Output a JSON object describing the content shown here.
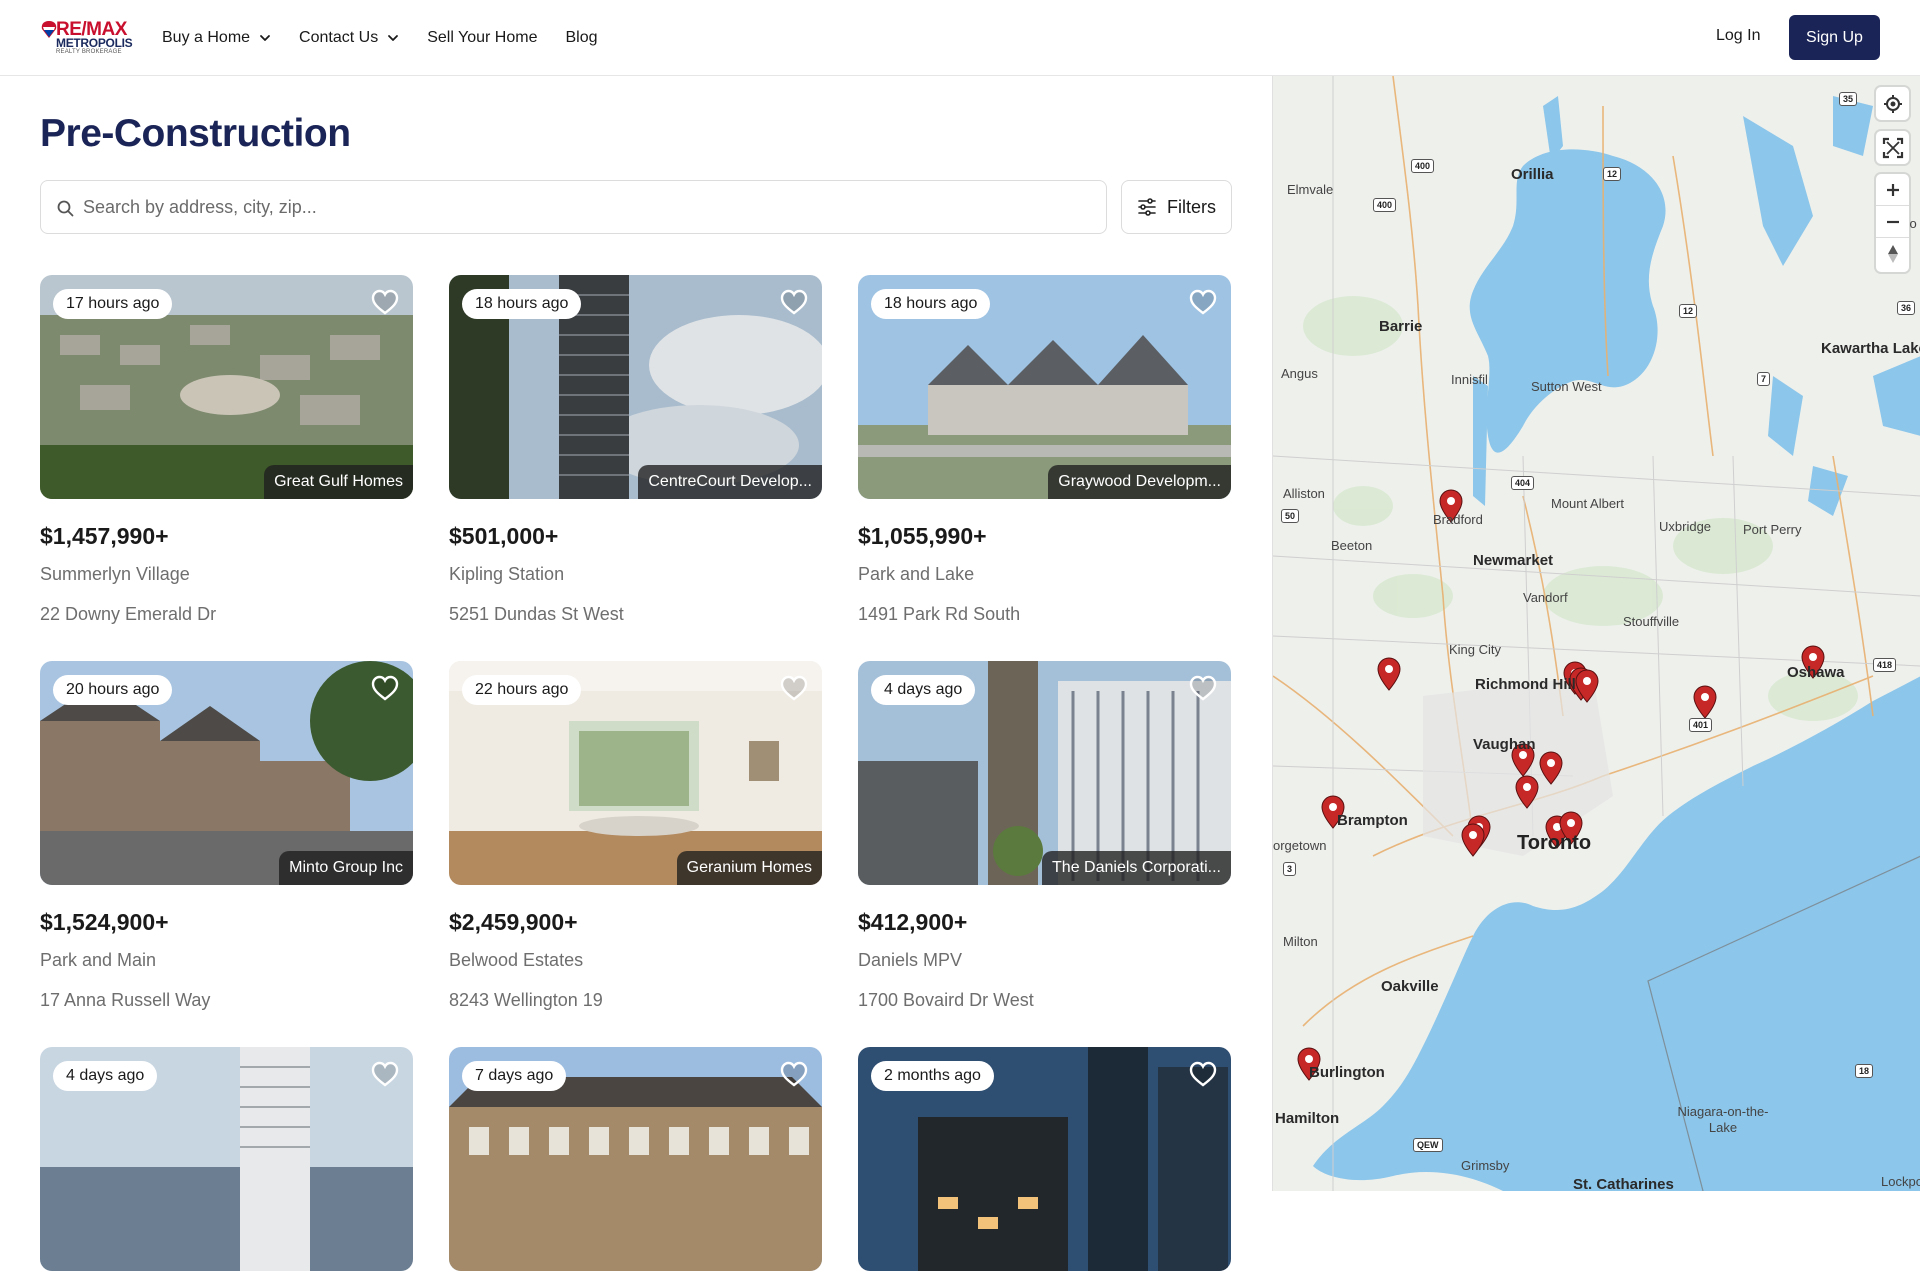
{
  "header": {
    "logo_brand": "RE/MAX",
    "logo_sub": "METROPOLIS",
    "logo_sub2": "REALTY BROKERAGE",
    "nav": [
      {
        "label": "Buy a Home",
        "dropdown": true
      },
      {
        "label": "Contact Us",
        "dropdown": true
      },
      {
        "label": "Sell Your Home",
        "dropdown": false
      },
      {
        "label": "Blog",
        "dropdown": false
      }
    ],
    "login": "Log In",
    "signup": "Sign Up"
  },
  "page": {
    "title": "Pre-Construction",
    "search_placeholder": "Search by address, city, zip...",
    "filters_label": "Filters"
  },
  "listings": [
    {
      "time": "17 hours ago",
      "builder": "Great Gulf Homes",
      "price": "$1,457,990+",
      "name": "Summerlyn Village",
      "address": "22 Downy Emerald Dr"
    },
    {
      "time": "18 hours ago",
      "builder": "CentreCourt Develop...",
      "price": "$501,000+",
      "name": "Kipling Station",
      "address": "5251 Dundas St West"
    },
    {
      "time": "18 hours ago",
      "builder": "Graywood Developm...",
      "price": "$1,055,990+",
      "name": "Park and Lake",
      "address": "1491 Park Rd South"
    },
    {
      "time": "20 hours ago",
      "builder": "Minto Group Inc",
      "price": "$1,524,900+",
      "name": "Park and Main",
      "address": "17 Anna Russell Way"
    },
    {
      "time": "22 hours ago",
      "builder": "Geranium Homes",
      "price": "$2,459,900+",
      "name": "Belwood Estates",
      "address": "8243 Wellington 19"
    },
    {
      "time": "4 days ago",
      "builder": "The Daniels Corporati...",
      "price": "$412,900+",
      "name": "Daniels MPV",
      "address": "1700 Bovaird Dr West"
    },
    {
      "time": "4 days ago",
      "builder": "",
      "price": "",
      "name": "",
      "address": ""
    },
    {
      "time": "7 days ago",
      "builder": "",
      "price": "",
      "name": "",
      "address": ""
    },
    {
      "time": "2 months ago",
      "builder": "",
      "price": "",
      "name": "",
      "address": ""
    }
  ],
  "map": {
    "places": [
      {
        "name": "Orillia",
        "size": "big"
      },
      {
        "name": "Elmvale",
        "size": "med"
      },
      {
        "name": "Barrie",
        "size": "big"
      },
      {
        "name": "Angus",
        "size": "med"
      },
      {
        "name": "Innisfil",
        "size": "med"
      },
      {
        "name": "Sutton West",
        "size": "med"
      },
      {
        "name": "Kawartha Lake",
        "size": "big"
      },
      {
        "name": "Alliston",
        "size": "med"
      },
      {
        "name": "Bradford",
        "size": "med"
      },
      {
        "name": "Mount Albert",
        "size": "med"
      },
      {
        "name": "Uxbridge",
        "size": "med"
      },
      {
        "name": "Port Perry",
        "size": "med"
      },
      {
        "name": "Beeton",
        "size": "med"
      },
      {
        "name": "Newmarket",
        "size": "big"
      },
      {
        "name": "Vandorf",
        "size": "med"
      },
      {
        "name": "Stouffville",
        "size": "med"
      },
      {
        "name": "King City",
        "size": "med"
      },
      {
        "name": "Richmond Hill",
        "size": "big"
      },
      {
        "name": "Oshawa",
        "size": "big"
      },
      {
        "name": "Vaughan",
        "size": "big"
      },
      {
        "name": "Brampton",
        "size": "big"
      },
      {
        "name": "Toronto",
        "size": "xl"
      },
      {
        "name": "orgetown",
        "size": "med"
      },
      {
        "name": "Milton",
        "size": "med"
      },
      {
        "name": "Oakville",
        "size": "big"
      },
      {
        "name": "Burlington",
        "size": "big"
      },
      {
        "name": "Hamilton",
        "size": "big"
      },
      {
        "name": "Niagara-on-the-Lake",
        "size": "med"
      },
      {
        "name": "Grimsby",
        "size": "med"
      },
      {
        "name": "St. Catharines",
        "size": "big"
      },
      {
        "name": "Fenelo",
        "size": "med"
      },
      {
        "name": "Lockpo",
        "size": "med"
      }
    ],
    "road_shields": [
      "35",
      "400",
      "400",
      "12",
      "12",
      "36",
      "7",
      "404",
      "50",
      "418",
      "401",
      "3",
      "18",
      "QEW"
    ]
  },
  "colors": {
    "brand_navy": "#1a2456",
    "water": "#8cc6ea",
    "land": "#eef0ec",
    "marker": "#c62828"
  },
  "icons": [
    "chevron-down-icon",
    "search-icon",
    "filters-icon",
    "heart-icon",
    "locate-icon",
    "fullscreen-icon",
    "zoom-in-icon",
    "zoom-out-icon",
    "compass-icon",
    "map-marker-icon"
  ]
}
